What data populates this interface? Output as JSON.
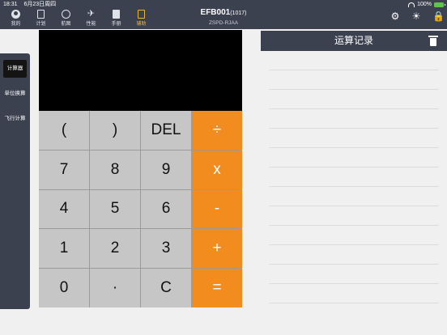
{
  "status": {
    "time": "18:31",
    "date": "6月23日周四",
    "battery": "100%"
  },
  "nav": [
    {
      "label": "我的",
      "icon": "user-icon"
    },
    {
      "label": "计划",
      "icon": "plan-icon"
    },
    {
      "label": "航图",
      "icon": "chart-icon"
    },
    {
      "label": "性能",
      "icon": "plane-icon"
    },
    {
      "label": "手册",
      "icon": "book-icon"
    },
    {
      "label": "辅助",
      "icon": "aux-icon",
      "active": true
    }
  ],
  "header": {
    "flight": "EFB001",
    "flight_suffix": "(1017)",
    "route": "ZSPD-RJAA"
  },
  "sidebar": {
    "items": [
      {
        "label": "计算器",
        "active": true
      },
      {
        "label": "单位换算"
      },
      {
        "label": "飞行计算"
      }
    ]
  },
  "calculator": {
    "display": "",
    "keys": [
      "(",
      ")",
      "DEL",
      "÷",
      "7",
      "8",
      "9",
      "x",
      "4",
      "5",
      "6",
      "-",
      "1",
      "2",
      "3",
      "+",
      "0",
      "·",
      "C",
      "="
    ]
  },
  "history": {
    "title": "运算记录",
    "entries": []
  },
  "colors": {
    "bar": "#3c4150",
    "accent": "#f28c1e",
    "active_nav": "#f0b23a"
  }
}
